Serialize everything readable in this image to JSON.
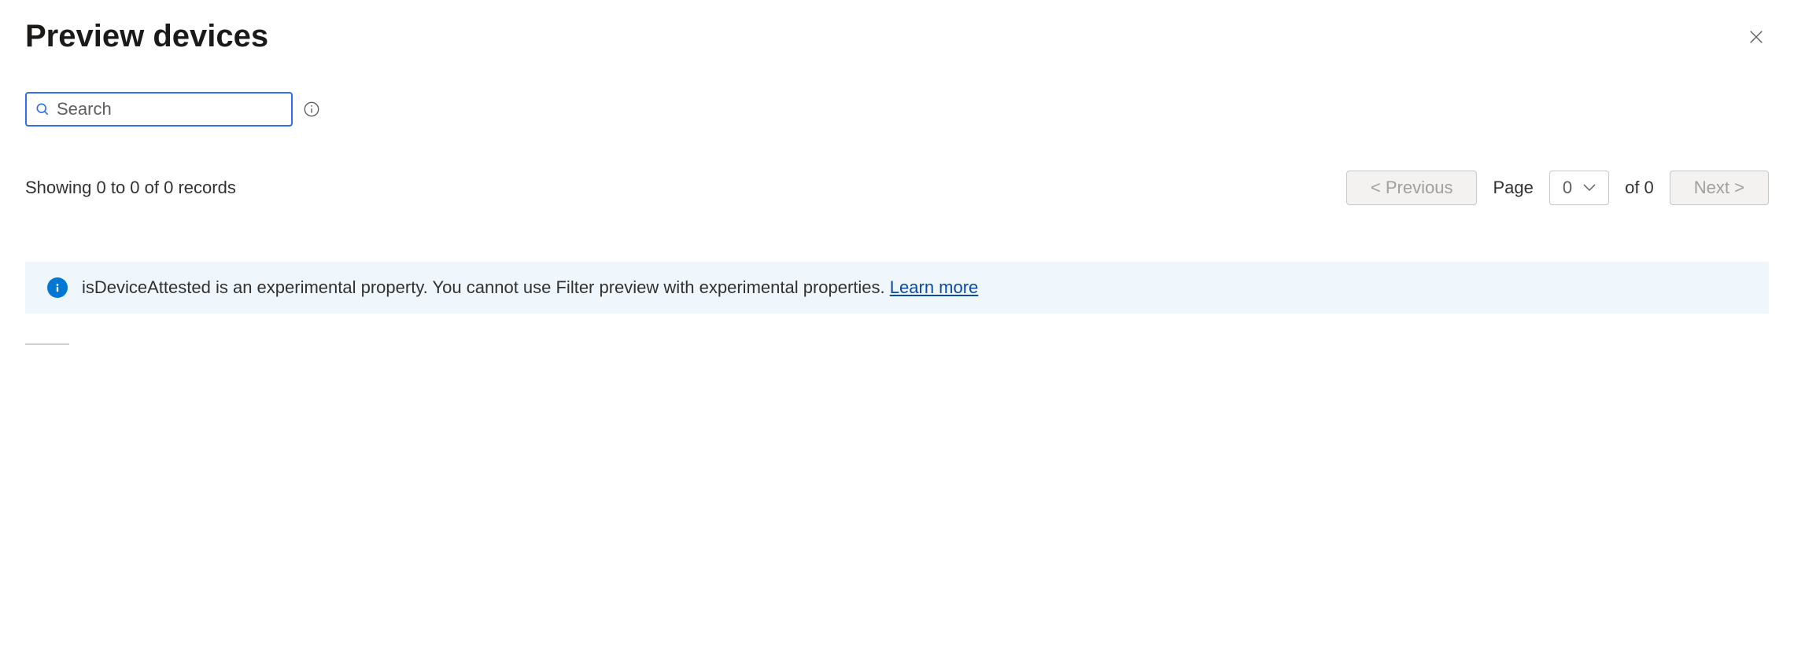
{
  "header": {
    "title": "Preview devices"
  },
  "search": {
    "placeholder": "Search"
  },
  "records": {
    "summary": "Showing 0 to 0 of 0 records"
  },
  "pager": {
    "previous_label": "<  Previous",
    "page_label": "Page",
    "current_page": "0",
    "of_label": "of 0",
    "next_label": "Next  >"
  },
  "banner": {
    "message": "isDeviceAttested is an experimental property. You cannot use Filter preview with experimental properties. ",
    "learn_more_label": "Learn more"
  }
}
